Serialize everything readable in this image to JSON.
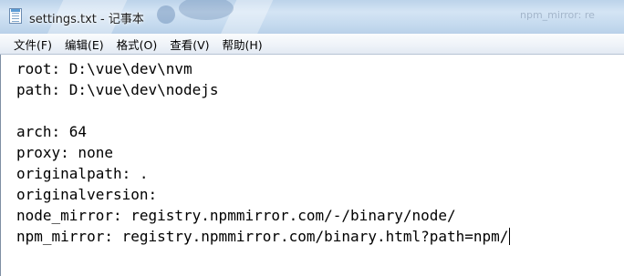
{
  "window": {
    "title": "settings.txt - 记事本",
    "background_text": "npm_mirror: re"
  },
  "menu": [
    {
      "name": "file",
      "label": "文件(F)"
    },
    {
      "name": "edit",
      "label": "编辑(E)"
    },
    {
      "name": "format",
      "label": "格式(O)"
    },
    {
      "name": "view",
      "label": "查看(V)"
    },
    {
      "name": "help",
      "label": "帮助(H)"
    }
  ],
  "document": {
    "lines": [
      "root: D:\\vue\\dev\\nvm",
      "path: D:\\vue\\dev\\nodejs",
      "",
      "arch: 64",
      "proxy: none",
      "originalpath: .",
      "originalversion:",
      "node_mirror: registry.npmmirror.com/-/binary/node/",
      "npm_mirror: registry.npmmirror.com/binary.html?path=npm/"
    ]
  },
  "colors": {
    "titlebar": "#c6dbef",
    "menubar": "#f0f4f9",
    "editor_bg": "#ffffff",
    "text": "#000000"
  },
  "icons": {
    "app": "notepad-icon"
  }
}
